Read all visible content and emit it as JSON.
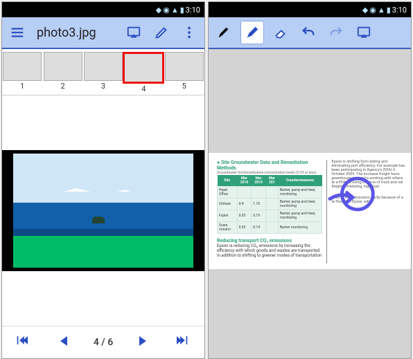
{
  "status": {
    "time": "3:10"
  },
  "left": {
    "title": "photo3.jpg",
    "thumbs": [
      {
        "n": "1"
      },
      {
        "n": "2"
      },
      {
        "n": "3"
      },
      {
        "n": "4"
      },
      {
        "n": "5"
      }
    ],
    "position": "4 / 6"
  },
  "right": {
    "doc": {
      "heading": "Site Groundwater Data and Remediation Methods",
      "sub": "Groundwater trichloroethylene concentration levels (0.03 or less)",
      "headers": [
        "Site",
        "Mar 2010",
        "Mar 2010",
        "Mar 201",
        "Countermeasures"
      ],
      "rows": [
        [
          "Head Office",
          "",
          "",
          "",
          "Barrier, pump and treat, monitoring"
        ],
        [
          "Chitose",
          "0.4",
          "1.10",
          "",
          "Barrier, pump and treat, monitoring"
        ],
        [
          "Fujimi",
          "0.03",
          "0.19",
          "",
          "Barrier, pump and treat, monitoring"
        ],
        [
          "Suwa minami",
          "0.03",
          "0.14",
          "",
          "Barrier monitoring"
        ]
      ],
      "heading2": "Reducing transport CO₂ emissions",
      "para": "Epson is reducing CO₂ emissions by increasing the efficiency with which goods and wastes are transported. In addition to shifting to greener modes of transportation",
      "col2": "Epson is shifting from dating and eliminating port efficiency. For example has been participating in Agency's (EFA) S October 2009. The increase freight trans greenhouse gas and a working with others to a EPA, by using informa of truck and rail freight scheduling, high load",
      "col2b": "In 2010 CO₂ emissions partly because of a te However, Epson will c"
    }
  }
}
